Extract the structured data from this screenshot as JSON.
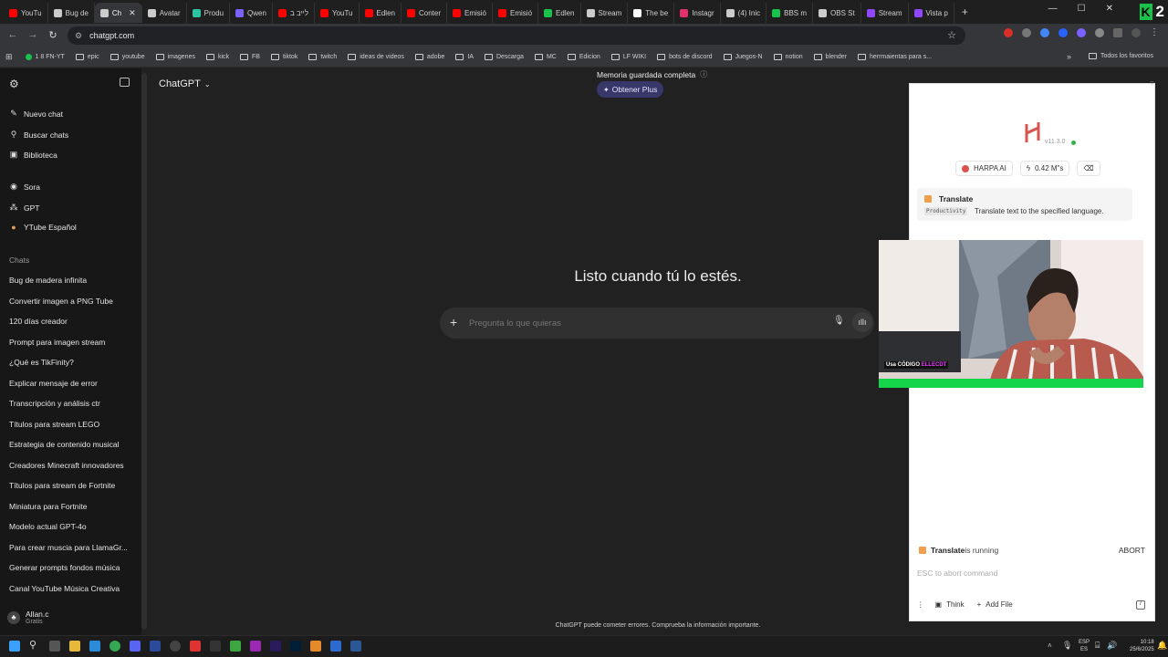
{
  "browser": {
    "tabs": [
      {
        "label": "YouTu",
        "color": "#ff0000"
      },
      {
        "label": "Bug de",
        "color": "#cccccc"
      },
      {
        "label": "Ch",
        "color": "#cccccc",
        "active": true
      },
      {
        "label": "Avatar",
        "color": "#cccccc"
      },
      {
        "label": "Produ",
        "color": "#2cc4a0"
      },
      {
        "label": "Qwen",
        "color": "#7b61ff"
      },
      {
        "label": "לייב ב",
        "color": "#ff0000"
      },
      {
        "label": "YouTu",
        "color": "#ff0000"
      },
      {
        "label": "Edlen",
        "color": "#ff0000"
      },
      {
        "label": "Conter",
        "color": "#ff0000"
      },
      {
        "label": "Emisió",
        "color": "#ff0000"
      },
      {
        "label": "Emisió",
        "color": "#ff0000"
      },
      {
        "label": "Edlen",
        "color": "#19c24b"
      },
      {
        "label": "Stream",
        "color": "#cccccc"
      },
      {
        "label": "The be",
        "color": "#ffffff"
      },
      {
        "label": "Instagr",
        "color": "#e1306c"
      },
      {
        "label": "(4) Inic",
        "color": "#cccccc"
      },
      {
        "label": "BBS m",
        "color": "#19c24b"
      },
      {
        "label": "OBS St",
        "color": "#cccccc"
      },
      {
        "label": "Stream",
        "color": "#9146ff"
      },
      {
        "label": "Vista p",
        "color": "#9146ff"
      }
    ],
    "new_tab": "+",
    "url": "chatgpt.com",
    "k_badge": "K",
    "k_count": "2"
  },
  "bookmarks": [
    {
      "label": "1 8 FN-YT",
      "folder": false
    },
    {
      "label": "epic",
      "folder": true
    },
    {
      "label": "youtube",
      "folder": true
    },
    {
      "label": "imagenes",
      "folder": true
    },
    {
      "label": "kick",
      "folder": true
    },
    {
      "label": "FB",
      "folder": true
    },
    {
      "label": "tiktok",
      "folder": true
    },
    {
      "label": "twitch",
      "folder": true
    },
    {
      "label": "ideas de videos",
      "folder": true
    },
    {
      "label": "adobe",
      "folder": true
    },
    {
      "label": "IA",
      "folder": true
    },
    {
      "label": "Descarga",
      "folder": true
    },
    {
      "label": "MC",
      "folder": true
    },
    {
      "label": "Edicion",
      "folder": true
    },
    {
      "label": "LF WIKI",
      "folder": true
    },
    {
      "label": "bots de discord",
      "folder": true
    },
    {
      "label": "Juegos-N",
      "folder": true
    },
    {
      "label": "notion",
      "folder": true
    },
    {
      "label": "blender",
      "folder": true
    },
    {
      "label": "herrmaientas para s...",
      "folder": true
    }
  ],
  "bookmarks_all": "Todos los favoritos",
  "sidebar": {
    "new_chat": "Nuevo chat",
    "search": "Buscar chats",
    "library": "Biblioteca",
    "sora": "Sora",
    "gpt": "GPT",
    "ytube": "YTube Español",
    "chats_header": "Chats",
    "chats": [
      "Bug de madera infinita",
      "Convertir imagen a PNG Tube",
      "120 días creador",
      "Prompt para imagen stream",
      "¿Qué es TikFinity?",
      "Explicar mensaje de error",
      "Transcripción y análisis ctr",
      "Títulos para stream LEGO",
      "Estrategia de contenido musical",
      "Creadores Minecraft innovadores",
      "Títulos para stream de Fortnite",
      "Miniatura para Fortnite",
      "Modelo actual GPT-4o",
      "Para crear muscia para LlamaGr...",
      "Generar prompts fondos música",
      "Canal YouTube Música Creativa"
    ],
    "user_name": "Allan.c",
    "user_plan": "Gratis"
  },
  "main": {
    "model": "ChatGPT",
    "memory": "Memoria guardada completa",
    "plus_button": "Obtener Plus",
    "heading": "Listo cuando tú lo estés.",
    "placeholder": "Pregunta lo que quieras",
    "disclaimer": "ChatGPT puede cometer errores. Comprueba la información importante."
  },
  "harpa": {
    "version": "v11.3.0",
    "brand": "HARPA AI",
    "speed": "0.42 M\"s",
    "command_title": "Translate",
    "command_tag": "Productivity",
    "command_desc": "Translate text to the specified language.",
    "running_name": "Translate",
    "running_suffix": " is running",
    "abort": "ABORT",
    "esc_hint": "ESC to abort command",
    "think": "Think",
    "add_file": "Add File",
    "accent": "#d9534f"
  },
  "webcam": {
    "overlay": "Usa CÓDIGO",
    "overlay_highlight": "ELLECDT"
  },
  "taskbar": {
    "lang": "ESP",
    "lang2": "ES",
    "time": "10:18",
    "date": "25/6/2025"
  }
}
